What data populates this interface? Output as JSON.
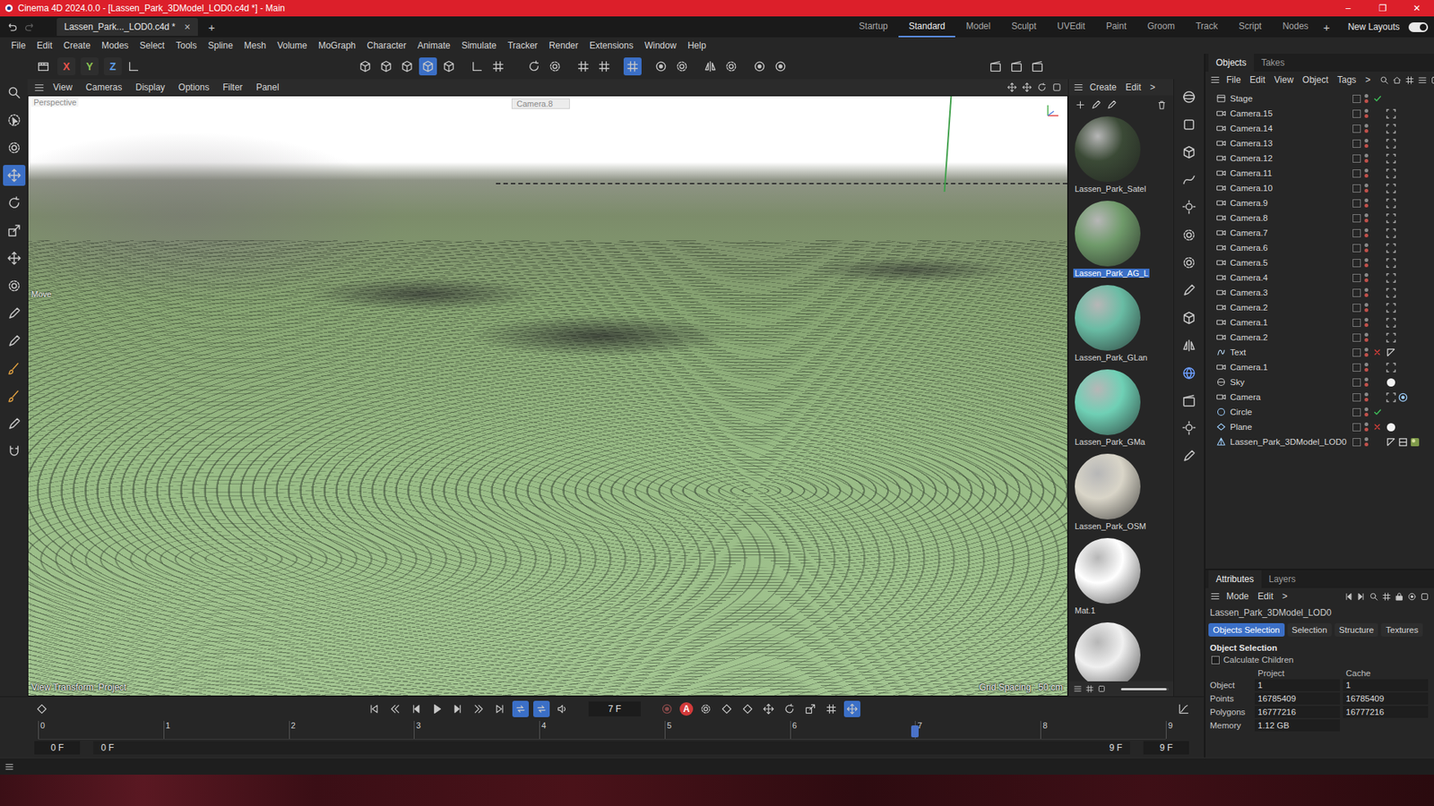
{
  "window": {
    "title": "Cinema 4D 2024.0.0 - [Lassen_Park_3DModel_LOD0.c4d *] - Main",
    "controls": [
      "–",
      "❐",
      "✕"
    ]
  },
  "doc_tabs": [
    {
      "label": "Lassen_Park..._LOD0.c4d *",
      "selected": true,
      "close": "×"
    }
  ],
  "new_tab": "+",
  "layouts": [
    {
      "label": "Startup",
      "selected": false
    },
    {
      "label": "Standard",
      "selected": true
    },
    {
      "label": "Model",
      "selected": false
    },
    {
      "label": "Sculpt",
      "selected": false
    },
    {
      "label": "UVEdit",
      "selected": false
    },
    {
      "label": "Paint",
      "selected": false
    },
    {
      "label": "Groom",
      "selected": false
    },
    {
      "label": "Track",
      "selected": false
    },
    {
      "label": "Script",
      "selected": false
    },
    {
      "label": "Nodes",
      "selected": false
    }
  ],
  "layout_add": "+",
  "new_layouts": {
    "label": "New Layouts",
    "on": true
  },
  "menu": [
    "File",
    "Edit",
    "Create",
    "Modes",
    "Select",
    "Tools",
    "Spline",
    "Mesh",
    "Volume",
    "MoGraph",
    "Character",
    "Animate",
    "Simulate",
    "Tracker",
    "Render",
    "Extensions",
    "Window",
    "Help"
  ],
  "toolbar": {
    "axes": [
      {
        "label": "X",
        "color": "#e5534b"
      },
      {
        "label": "Y",
        "color": "#8cc152"
      },
      {
        "label": "Z",
        "color": "#5b9be6"
      }
    ],
    "buttons": [
      {
        "selected": false
      },
      {
        "selected": false
      },
      {
        "selected": false
      },
      {
        "selected": false
      },
      {
        "selected": false
      },
      {
        "selected": true
      },
      {
        "selected": false
      },
      {
        "selected": false
      },
      {
        "selected": false
      },
      {
        "selected": false
      },
      {
        "selected": false
      },
      {
        "selected": false
      },
      {
        "selected": false
      },
      {
        "selected": true
      },
      {
        "selected": false
      },
      {
        "selected": false
      },
      {
        "selected": false
      },
      {
        "selected": false
      },
      {
        "selected": false
      },
      {
        "selected": false
      },
      {
        "selected": false
      },
      {
        "selected": false
      },
      {
        "selected": false
      }
    ]
  },
  "left_tools": [
    {
      "selected": false
    },
    {
      "selected": false
    },
    {
      "selected": false
    },
    {
      "selected": true
    },
    {
      "selected": false
    },
    {
      "selected": false
    },
    {
      "selected": false
    },
    {
      "selected": false
    },
    {
      "selected": false
    },
    {
      "selected": false
    },
    {
      "selected": false
    },
    {
      "selected": false
    },
    {
      "selected": false
    },
    {
      "selected": false
    }
  ],
  "viewport": {
    "menu": [
      "View",
      "Cameras",
      "Display",
      "Options",
      "Filter",
      "Panel"
    ],
    "camera_name": "Perspective",
    "active_camera": "Camera.8",
    "tool_label": "Move",
    "view_transform": "View Transform: Project",
    "grid_spacing": "Grid Spacing : 50 cm"
  },
  "materials": {
    "menu": [
      "Create",
      "Edit",
      ">"
    ],
    "zoom_level": 0.95,
    "items": [
      {
        "name": "Lassen_Park_Satel",
        "color": "#3b4a36",
        "selected": false
      },
      {
        "name": "Lassen_Park_AG_L",
        "color": "#6f9a6a",
        "selected": true
      },
      {
        "name": "Lassen_Park_GLan",
        "color": "#69bca4",
        "selected": false
      },
      {
        "name": "Lassen_Park_GMa",
        "color": "#6fd0b5",
        "selected": false
      },
      {
        "name": "Lassen_Park_OSM",
        "color": "#d9d5c8",
        "selected": false
      },
      {
        "name": "Mat.1",
        "color": "#ffffff",
        "selected": false
      },
      {
        "name": null,
        "color": "#f0f0f0",
        "selected": false
      }
    ]
  },
  "objects": {
    "tabs": [
      {
        "label": "Objects",
        "selected": true
      },
      {
        "label": "Takes",
        "selected": false
      }
    ],
    "menu": [
      "File",
      "Edit",
      "View",
      "Object",
      "Tags",
      ">"
    ],
    "items": [
      {
        "name": "Stage",
        "kind": "stage",
        "status": "check",
        "tags": []
      },
      {
        "name": "Camera.15",
        "kind": "camera",
        "status": "none",
        "tags": [
          "protect"
        ]
      },
      {
        "name": "Camera.14",
        "kind": "camera",
        "status": "none",
        "tags": [
          "protect"
        ]
      },
      {
        "name": "Camera.13",
        "kind": "camera",
        "status": "none",
        "tags": [
          "protect"
        ]
      },
      {
        "name": "Camera.12",
        "kind": "camera",
        "status": "none",
        "tags": [
          "protect"
        ]
      },
      {
        "name": "Camera.11",
        "kind": "camera",
        "status": "none",
        "tags": [
          "protect"
        ]
      },
      {
        "name": "Camera.10",
        "kind": "camera",
        "status": "none",
        "tags": [
          "protect"
        ]
      },
      {
        "name": "Camera.9",
        "kind": "camera",
        "status": "none",
        "tags": [
          "protect"
        ]
      },
      {
        "name": "Camera.8",
        "kind": "camera",
        "status": "none",
        "tags": [
          "protect"
        ]
      },
      {
        "name": "Camera.7",
        "kind": "camera",
        "status": "none",
        "tags": [
          "protect"
        ]
      },
      {
        "name": "Camera.6",
        "kind": "camera",
        "status": "none",
        "tags": [
          "protect"
        ]
      },
      {
        "name": "Camera.5",
        "kind": "camera",
        "status": "none",
        "tags": [
          "protect"
        ]
      },
      {
        "name": "Camera.4",
        "kind": "camera",
        "status": "none",
        "tags": [
          "protect"
        ]
      },
      {
        "name": "Camera.3",
        "kind": "camera",
        "status": "none",
        "tags": [
          "protect"
        ]
      },
      {
        "name": "Camera.2",
        "kind": "camera",
        "status": "none",
        "tags": [
          "protect"
        ]
      },
      {
        "name": "Camera.1",
        "kind": "camera",
        "status": "none",
        "tags": [
          "protect"
        ]
      },
      {
        "name": "Camera.2",
        "kind": "camera",
        "status": "none",
        "tags": [
          "protect"
        ]
      },
      {
        "name": "Text",
        "kind": "text",
        "status": "cross",
        "tags": [
          "phong"
        ]
      },
      {
        "name": "Camera.1",
        "kind": "camera",
        "status": "none",
        "tags": [
          "protect"
        ]
      },
      {
        "name": "Sky",
        "kind": "sky",
        "status": "none",
        "tags": [
          "sky"
        ]
      },
      {
        "name": "Camera",
        "kind": "camera",
        "status": "none",
        "tags": [
          "protect",
          "target"
        ]
      },
      {
        "name": "Circle",
        "kind": "circle",
        "status": "check",
        "tags": []
      },
      {
        "name": "Plane",
        "kind": "plane",
        "status": "cross",
        "tags": [
          "sky"
        ]
      },
      {
        "name": "Lassen_Park_3DModel_LOD0",
        "kind": "mesh",
        "status": "none",
        "tags": [
          "phong",
          "uvw",
          "material"
        ]
      }
    ]
  },
  "attributes": {
    "tabs": [
      {
        "label": "Attributes",
        "selected": true
      },
      {
        "label": "Layers",
        "selected": false
      }
    ],
    "menu": [
      "Mode",
      "Edit",
      ">"
    ],
    "object_name": "Lassen_Park_3DModel_LOD0",
    "sub_tabs": [
      {
        "label": "Objects Selection",
        "selected": true
      },
      {
        "label": "Selection",
        "selected": false
      },
      {
        "label": "Structure",
        "selected": false
      },
      {
        "label": "Textures",
        "selected": false
      }
    ],
    "section": "Object Selection",
    "options": [
      {
        "label": "Calculate Children",
        "checked": false
      }
    ],
    "columns": [
      "Project",
      "Cache"
    ],
    "rows": [
      {
        "label": "Object",
        "values": [
          "1",
          "1"
        ]
      },
      {
        "label": "Points",
        "values": [
          "16785409",
          "16785409"
        ]
      },
      {
        "label": "Polygons",
        "values": [
          "16777216",
          "16777216"
        ]
      },
      {
        "label": "Memory",
        "values": [
          "1.12 GB"
        ]
      }
    ]
  },
  "timeline": {
    "current_frame": "7 F",
    "autokey_label": "A",
    "ruler": [
      "0",
      "1",
      "2",
      "3",
      "4",
      "5",
      "6",
      "7",
      "8",
      "9"
    ],
    "level": 0.7778,
    "start": "0 F",
    "range_start": "0 F",
    "range_end": "9 F",
    "end": "9 F",
    "buttons_left": [
      {
        "selected": false
      },
      {
        "selected": false
      },
      {
        "selected": false
      },
      {
        "selected": false
      },
      {
        "selected": false
      },
      {
        "selected": false
      },
      {
        "selected": false
      },
      {
        "selected": true
      },
      {
        "selected": true
      },
      {
        "selected": false
      }
    ],
    "buttons_right": [
      {
        "selected": false
      },
      {
        "selected": false
      },
      {
        "selected": false
      },
      {
        "selected": false
      },
      {
        "selected": false
      },
      {
        "selected": false
      },
      {
        "selected": false
      },
      {
        "selected": false
      },
      {
        "selected": true
      }
    ]
  }
}
